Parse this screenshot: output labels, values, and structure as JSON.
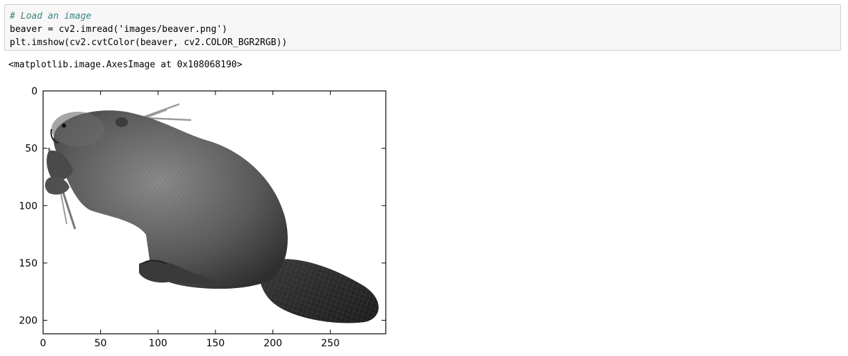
{
  "notebook": {
    "input_cell": {
      "lines": [
        {
          "kind": "comment",
          "text": "# Load an image"
        },
        {
          "kind": "code",
          "text": "beaver = cv2.imread('images/beaver.png')"
        },
        {
          "kind": "code",
          "text": "plt.imshow(cv2.cvtColor(beaver, cv2.COLOR_BGR2RGB))"
        }
      ]
    },
    "output": {
      "text": "<matplotlib.image.AxesImage at 0x108068190>"
    },
    "figure": {
      "image_subject": "beaver",
      "x_ticks": [
        "0",
        "50",
        "100",
        "150",
        "200",
        "250"
      ],
      "y_ticks": [
        "0",
        "50",
        "100",
        "150",
        "200"
      ]
    }
  },
  "colors": {
    "cell_background": "#f7f7f7",
    "cell_border": "#cfcfcf",
    "comment": "#408080",
    "axes": "#000000"
  }
}
